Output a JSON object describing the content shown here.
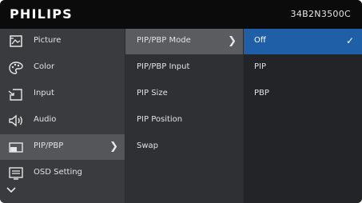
{
  "header": {
    "brand": "PHILIPS",
    "model": "34B2N3500C"
  },
  "menu": {
    "items": [
      {
        "label": "Picture",
        "icon": "picture-icon"
      },
      {
        "label": "Color",
        "icon": "palette-icon"
      },
      {
        "label": "Input",
        "icon": "input-icon"
      },
      {
        "label": "Audio",
        "icon": "speaker-icon"
      },
      {
        "label": "PIP/PBP",
        "icon": "pip-icon",
        "selected": true
      },
      {
        "label": "OSD Setting",
        "icon": "osd-setting-icon"
      }
    ],
    "more_icon": "chevron-down-icon"
  },
  "submenu": {
    "items": [
      {
        "label": "PIP/PBP Mode",
        "selected": true
      },
      {
        "label": "PIP/PBP Input"
      },
      {
        "label": "PIP Size"
      },
      {
        "label": "PIP Position"
      },
      {
        "label": "Swap"
      }
    ]
  },
  "options": {
    "items": [
      {
        "label": "Off",
        "selected": true,
        "checkmark": "✓"
      },
      {
        "label": "PIP"
      },
      {
        "label": "PBP"
      }
    ]
  },
  "colors": {
    "highlight_blue": "#1f5fa8",
    "header": "#0b0b0c"
  }
}
